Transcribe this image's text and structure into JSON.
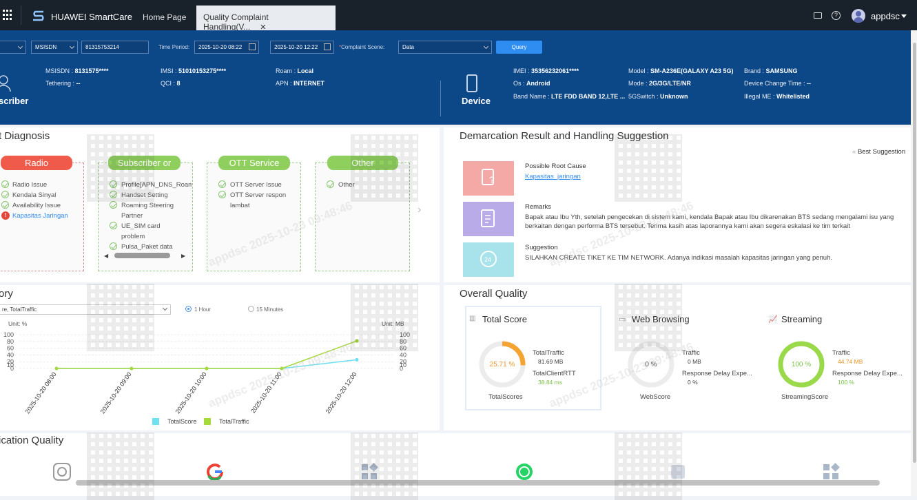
{
  "app": {
    "brand": "HUAWEI SmartCare",
    "user": "appdsc"
  },
  "tabs": [
    {
      "label": "Home Page"
    },
    {
      "label": "Quality Complaint Handling(V..."
    }
  ],
  "query": {
    "type_value": "MSISDN",
    "msisdn_value": "81315753214",
    "time_period_label": "Time Period:",
    "start_time": "2025-10-20 08:22",
    "end_time": "2025-10-20 12:22",
    "scene_label": "Complaint Scene:",
    "scene_required": "*",
    "scene_value": "Data",
    "query_label": "Query"
  },
  "subscriber": {
    "label": "scriber",
    "msisdn_k": "MSISDN : ",
    "msisdn_v": "8131575****",
    "imsi_k": "IMSI : ",
    "imsi_v": "51010153275****",
    "roam_k": "Roam : ",
    "roam_v": "Local",
    "tether_k": "Tethering : ",
    "tether_v": "--",
    "qci_k": "QCI : ",
    "qci_v": "8",
    "apn_k": "APN : ",
    "apn_v": "INTERNET"
  },
  "device": {
    "label": "Device",
    "imei_k": "IMEI : ",
    "imei_v": "35356232061****",
    "model_k": "Model : ",
    "model_v": "SM-A236E(GALAXY A23 5G)",
    "brand_k": "Brand : ",
    "brand_v": "SAMSUNG",
    "os_k": "Os : ",
    "os_v": "Android",
    "mode_k": "Mode : ",
    "mode_v": "2G/3G/LTE/NR",
    "dct_k": "Device Change Time : ",
    "dct_v": "--",
    "band_k": "Band Name : ",
    "band_v": "LTE FDD BAND 12,LTE ...",
    "sg_k": "5GSwitch : ",
    "sg_v": "Unknown",
    "ill_k": "Illegal ME : ",
    "ill_v": "Whitelisted"
  },
  "diagnosis": {
    "title": "t Diagnosis",
    "cols": [
      {
        "title": "Radio",
        "color": "#f05a4a",
        "items": [
          "Radio Issue",
          "Kendala Sinyal",
          "Availability Issue",
          "Kapasitas Jaringan"
        ]
      },
      {
        "title": "Subscriber or De...",
        "color": "#8fcf5e",
        "items": [
          "Profile[APN_DNS_Roam",
          "Handset Setting",
          "Roaming Steering",
          "Partner",
          "UE_SIM card",
          "problem",
          "Pulsa_Paket data"
        ]
      },
      {
        "title": "OTT Service",
        "color": "#8fcf5e",
        "items": [
          "OTT Server Issue",
          "OTT Server respon",
          "lambat"
        ]
      },
      {
        "title": "Other",
        "color": "#8fcf5e",
        "items": [
          "Other"
        ]
      }
    ]
  },
  "demarcation": {
    "title": "Demarcation Result and Handling Suggestion",
    "best": "Best Suggestion",
    "root_cause_title": "Possible Root Cause",
    "root_cause_link": "Kapasitas_jaringan",
    "remarks_title": "Remarks",
    "remarks_text": "Bapak atau Ibu Yth, setelah pengecekan di sistem kami, kendala Bapak atau Ibu dikarenakan BTS sedang mengalami isu yang berkaitan dengan performa BTS tersebut. Terima kasih atas laporannya kami akan segera eskalasi ke tim terkait",
    "suggestion_title": "Suggestion",
    "suggestion_text": "SILAHKAN CREATE TIKET KE TIM NETWORK. Adanya indikasi masalah kapasitas jaringan yang penuh."
  },
  "history": {
    "title": "ory",
    "select_value": "re, TotalTraffic",
    "radio_1h": "1 Hour",
    "radio_15m": "15 Minutes",
    "unit_left": "Unit: %",
    "unit_right": "Unit: MB"
  },
  "chart_data": {
    "type": "line",
    "x": [
      "2025-10-20 08:00",
      "2025-10-20 09:00",
      "2025-10-20 10:00",
      "2025-10-20 11:00",
      "2025-10-20 12:00"
    ],
    "series": [
      {
        "name": "TotalScore",
        "color": "#6ee0f0",
        "values": [
          0,
          0,
          0,
          0,
          25.71
        ]
      },
      {
        "name": "TotalTraffic",
        "color": "#a6d93a",
        "values": [
          0,
          0,
          0,
          0,
          81.69
        ]
      }
    ],
    "ylim_left": [
      0,
      100
    ],
    "ylim_right": [
      0,
      100
    ],
    "yticks": [
      0,
      10,
      20,
      40,
      60,
      80,
      100
    ],
    "legend": "bottom"
  },
  "overall": {
    "title": "Overall Quality",
    "total": {
      "title": "Total Score",
      "score": "25.71 %",
      "score_value": 25.71,
      "caption": "TotalScores",
      "traffic_k": "TotalTraffic",
      "traffic_v": "81.69 MB",
      "rtt_k": "TotalClientRTT",
      "rtt_v": "38.84 ms"
    },
    "web": {
      "title": "Web Browsing",
      "score": "0 %",
      "score_value": 0,
      "caption": "WebScore",
      "traffic_k": "Traffic",
      "traffic_v": "0 MB",
      "delay_k": "Response Delay Expe...",
      "delay_v": "0 %"
    },
    "stream": {
      "title": "Streaming",
      "score": "100 %",
      "score_value": 100,
      "caption": "StreamingScore",
      "traffic_k": "Traffic",
      "traffic_v": "44.74 MB",
      "delay_k": "Response Delay Expe...",
      "delay_v": "100 %"
    }
  },
  "appq": {
    "title": "ication Quality"
  },
  "watermark": "appdsc 2025-10-23 09:48:46"
}
